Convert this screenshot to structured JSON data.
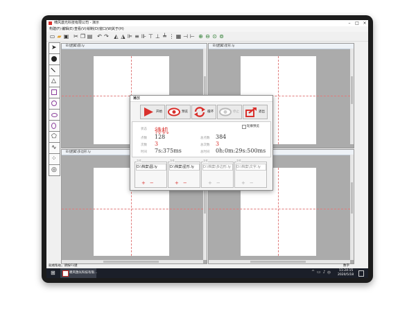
{
  "window": {
    "title": "啸风激光科技有限公司 - 演示"
  },
  "menu": [
    "构建(F)",
    "编辑(E)",
    "查看(V)",
    "绘制(D)",
    "窗口(W)",
    "关于(H)"
  ],
  "panes": [
    {
      "title": "D:\\档案\\圆.ly"
    },
    {
      "title": "D:\\档案\\星形.ly"
    },
    {
      "title": "D:\\档案\\多边形.ly"
    },
    {
      "title": "D:\\档案\\文字.ly"
    }
  ],
  "dialog": {
    "title": "播放",
    "buttons": {
      "start": "开始",
      "preview": "预览",
      "loop": "循环",
      "stop": "停止",
      "exit": "退出"
    },
    "checkbox": "轮廓预览",
    "state_label": "状态",
    "state_value": "待机",
    "points_label": "点数",
    "points_value": "128",
    "total_points_label": "总点数",
    "total_points_value": "384",
    "count_label": "次数",
    "count_value": "3",
    "total_count_label": "总次数",
    "total_count_value": "3",
    "time_label": "时间",
    "time_value": "7s:375ms",
    "total_time_label": "总时间",
    "total_time_value": "0h:0m:29s:500ms",
    "files": [
      {
        "label": "文件",
        "value": "D:\\档案\\圆.ly",
        "enabled": true
      },
      {
        "label": "文件",
        "value": "D:\\档案\\星形.ly",
        "enabled": true
      },
      {
        "label": "文件",
        "value": "D:\\档案\\多边形.ly",
        "enabled": false
      },
      {
        "label": "文件",
        "value": "D:\\档案\\文字.ly",
        "enabled": false
      }
    ],
    "plus": "+",
    "minus": "−"
  },
  "status": {
    "left": "就绪帮助，请按F1键",
    "right": "数字"
  },
  "taskbar": {
    "app_title": "啸风激光科技有限...",
    "time": "11:24:15",
    "date": "2020/5/18"
  },
  "colors": {
    "accent": "#d9302c",
    "canvas_bg": "#ababab",
    "taskbar": "#1b1f29"
  }
}
